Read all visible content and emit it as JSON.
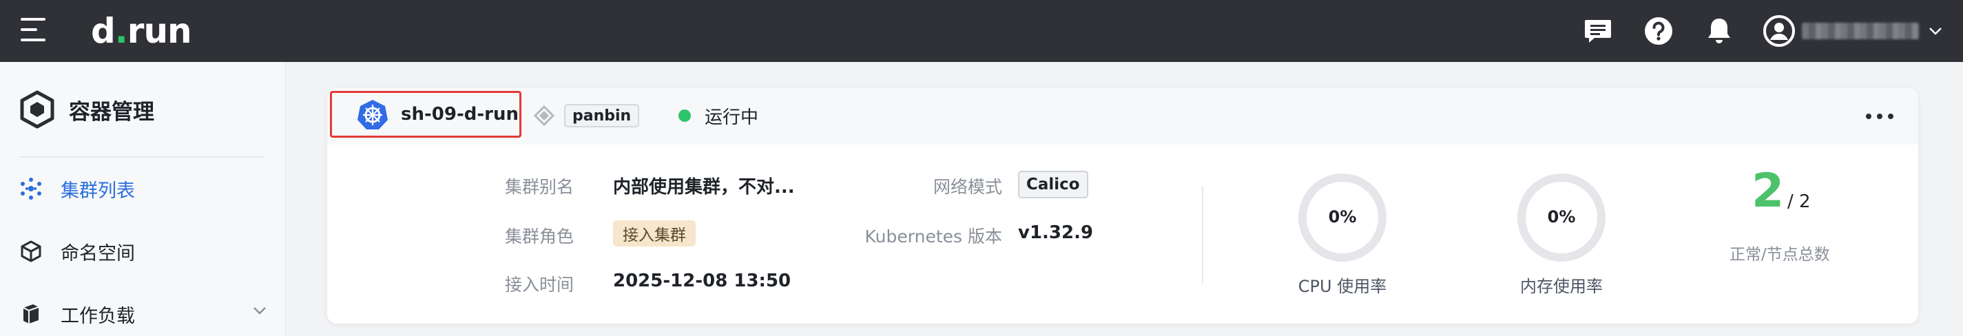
{
  "app": {
    "logo_prefix": "d",
    "logo_dot": ".",
    "logo_suffix": "run"
  },
  "topbar": {
    "icons": [
      "chat-icon",
      "help-icon",
      "bell-icon",
      "user-avatar-icon",
      "chevron-down-icon"
    ]
  },
  "sidebar": {
    "title": "容器管理",
    "items": [
      {
        "label": "集群列表",
        "icon": "cluster-icon",
        "active": true
      },
      {
        "label": "命名空间",
        "icon": "namespace-cube-icon",
        "active": false
      },
      {
        "label": "工作负载",
        "icon": "workload-icon",
        "active": false,
        "expandable": true
      }
    ]
  },
  "cluster": {
    "name": "sh-09-d-run",
    "owner": "panbin",
    "status": "运行中",
    "status_color": "#2ec46b",
    "fields": {
      "alias_label": "集群别名",
      "alias_value": "内部使用集群，不对...",
      "role_label": "集群角色",
      "role_value": "接入集群",
      "time_label": "接入时间",
      "time_value": "2025-12-08 13:50",
      "network_label": "网络模式",
      "network_value": "Calico",
      "k8s_label": "Kubernetes 版本",
      "k8s_value": "v1.32.9"
    },
    "metrics": {
      "cpu_value": "0%",
      "cpu_fraction": 0,
      "cpu_label": "CPU 使用率",
      "mem_value": "0%",
      "mem_fraction": 0,
      "mem_label": "内存使用率"
    },
    "nodes": {
      "ready": "2",
      "total": "/ 2",
      "label": "正常/节点总数",
      "ready_color": "#4cc26b"
    }
  }
}
